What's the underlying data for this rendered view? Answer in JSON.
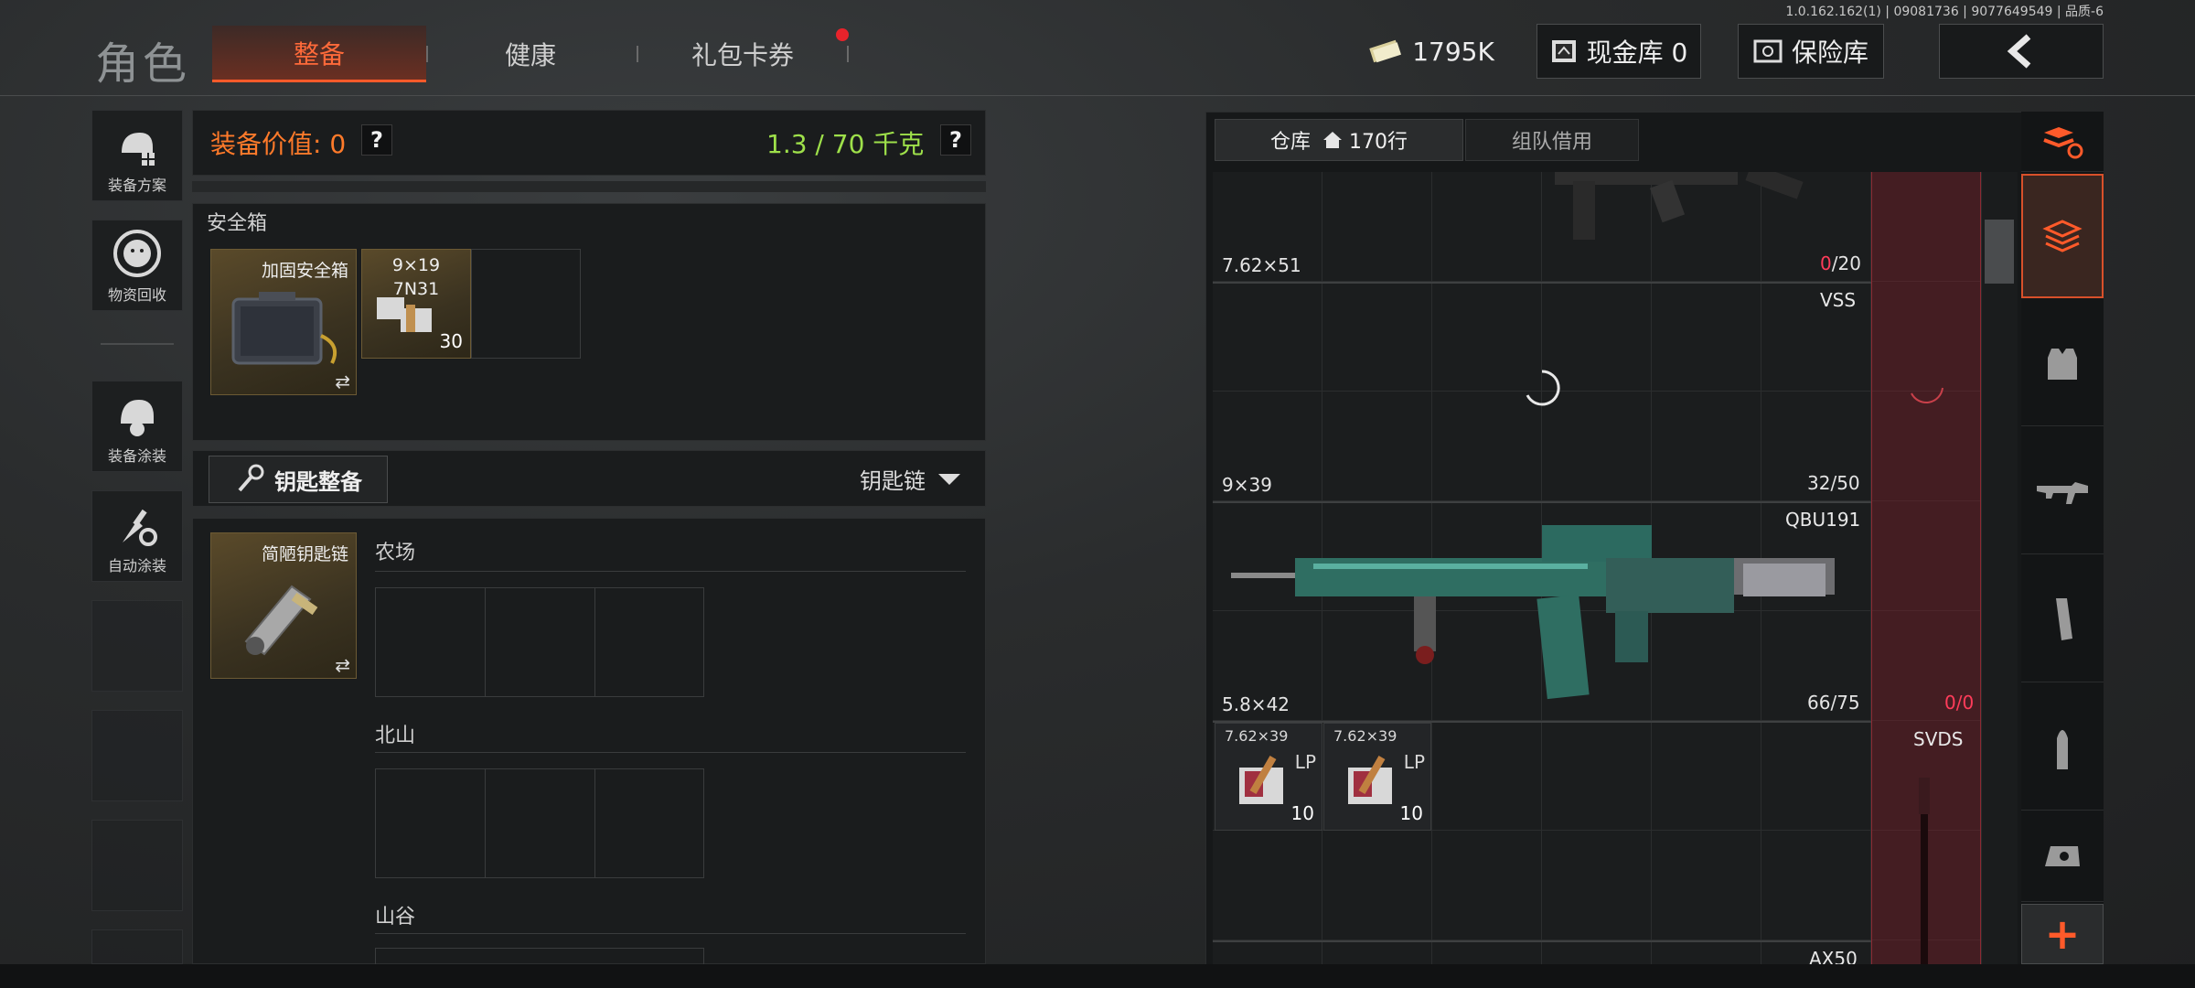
{
  "header": {
    "title": "角色",
    "tabs": [
      {
        "label": "整备",
        "active": true
      },
      {
        "label": "健康",
        "active": false
      },
      {
        "label": "礼包卡券",
        "active": false,
        "notification_dot": true
      }
    ],
    "version": "1.0.162.162(1) | 09081736 | 9077649549 | 品质-6",
    "money": "1795K",
    "cash_vault": "现金库 0",
    "insurance_vault": "保险库"
  },
  "left_menu": {
    "items": [
      {
        "label": "装备方案",
        "icon": "helmet-gear-icon"
      },
      {
        "label": "物资回收",
        "icon": "recycle-face-icon"
      },
      {
        "label": "装备涂装",
        "icon": "helmet-paint-icon"
      },
      {
        "label": "自动涂装",
        "icon": "brush-gear-icon"
      }
    ]
  },
  "loadout": {
    "value_label": "装备价值: 0",
    "weight_label": "1.3 / 70 千克",
    "help": "?"
  },
  "safe_box": {
    "section_title": "安全箱",
    "container_name": "加固安全箱",
    "swap_glyph": "⇄",
    "ammo_item": {
      "caliber": "9×19",
      "type": "7N31",
      "count": "30"
    }
  },
  "keys": {
    "button_label": "钥匙整备",
    "dropdown_label": "钥匙链",
    "keychain_name": "简陋钥匙链",
    "swap_glyph": "⇄",
    "sections": [
      "农场",
      "北山",
      "山谷"
    ]
  },
  "warehouse": {
    "tab_storage": "仓库",
    "tab_rows": "170行",
    "tab_team": "组队借用",
    "rows": [
      {
        "caliber": "7.62×51",
        "ammo_cur": "0",
        "ammo_max": "/20",
        "name": ""
      },
      {
        "caliber": "9×39",
        "ammo": "32/50",
        "name": "VSS"
      },
      {
        "caliber": "5.8×42",
        "ammo": "66/75",
        "name": "QBU191",
        "side_cur": "0",
        "side_max": "/0"
      },
      {
        "name": "SVDS"
      },
      {
        "name": "AX50"
      }
    ],
    "ammo_boxes": [
      {
        "caliber": "7.62×39",
        "type": "LP",
        "count": "10"
      },
      {
        "caliber": "7.62×39",
        "type": "LP",
        "count": "10"
      }
    ]
  },
  "colors": {
    "accent": "#ff5a2a",
    "value_orange": "#ff7a2a",
    "weight_green": "#9ee04a",
    "ammo_red": "#ff3c5a"
  }
}
